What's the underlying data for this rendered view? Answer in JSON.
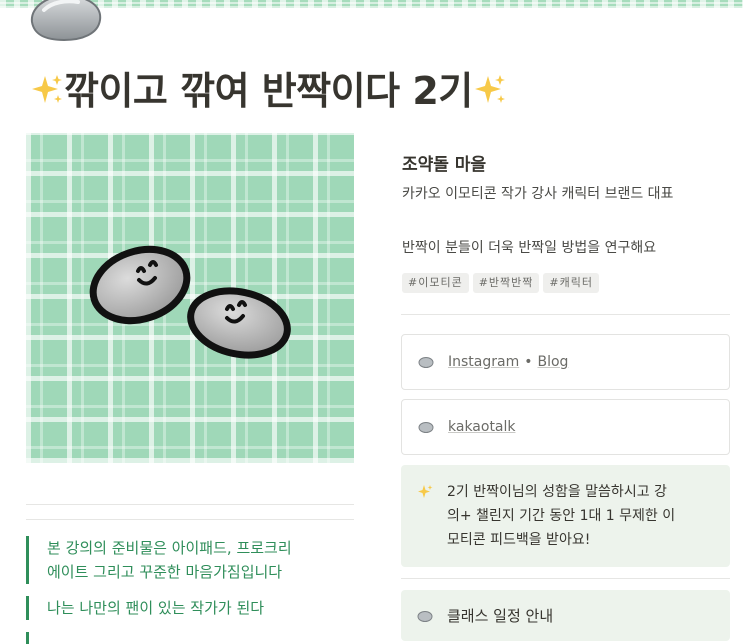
{
  "header": {
    "title": "✨깎이고 깎여 반짝이다 2기✨",
    "title_text": "깎이고 깎여 반짝이다 2기",
    "page_icon": "stone-icon",
    "title_icons": [
      "sparkles-icon",
      "sparkles-icon"
    ]
  },
  "cover": {
    "image": "plaid-stones-illustration",
    "colors": {
      "plaid": "#9fd8b8",
      "accent": "#2f8e5a"
    }
  },
  "quotes": [
    "본 강의의 준비물은 아이패드, 프로크리에이트 그리고 꾸준한 마음가짐입니다",
    "나는 나만의 팬이 있는 작가가 된다"
  ],
  "quote_lines": {
    "q1_line1": "본 강의의 준비물은 아이패드, 프로크리",
    "q1_line2": "에이트 그리고 꾸준한 마음가짐입니다",
    "q2": "나는 나만의 팬이 있는 작가가 된다"
  },
  "profile": {
    "name": "조약돌 마을",
    "description": "카카오 이모티콘 작가 강사 캐릭터 브랜드 대표",
    "subtitle": "반짝이 분들이 더욱 반짝일 방법을 연구해요",
    "tags": [
      "#이모티콘",
      "#반짝반짝",
      "#캐릭터"
    ]
  },
  "links": {
    "instagram": "Instagram",
    "separator": "•",
    "blog": "Blog",
    "kakaotalk": "kakaotalk"
  },
  "callouts": {
    "benefit_line1": "2기 반짝이님의 성함을 말씀하시고 강",
    "benefit_line2": "의+ 챌린지 기간 동안 1대 1 무제한 이",
    "benefit_line3": "모티콘 피드백을 받아요!",
    "schedule": "클래스 일정 안내"
  },
  "icons": {
    "stone": "stone-icon",
    "sparkle": "sparkles-icon"
  }
}
